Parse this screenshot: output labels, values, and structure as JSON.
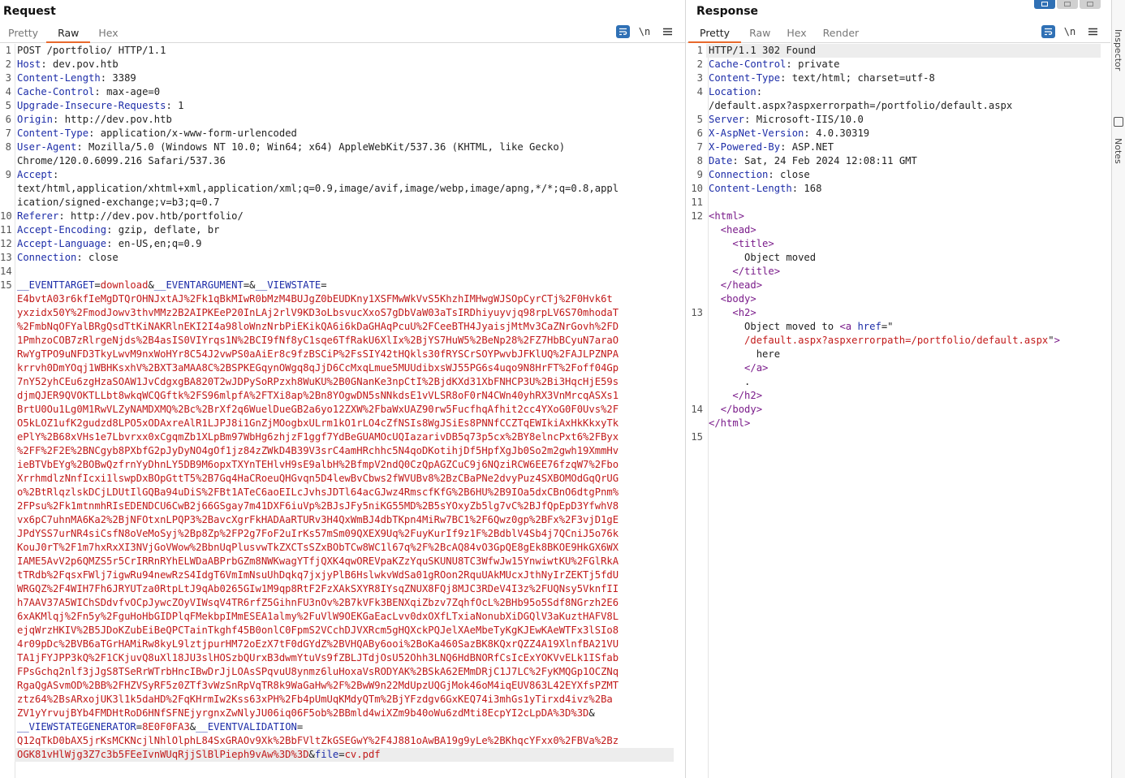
{
  "request": {
    "title": "Request",
    "tabs": [
      "Pretty",
      "Raw",
      "Hex"
    ],
    "active_tab": 1,
    "newline_label": "\\n",
    "headers": [
      {
        "n": "1",
        "plain": "POST /portfolio/ HTTP/1.1"
      },
      {
        "n": "2",
        "key": "Host",
        "value": " dev.pov.htb"
      },
      {
        "n": "3",
        "key": "Content-Length",
        "value": " 3389"
      },
      {
        "n": "4",
        "key": "Cache-Control",
        "value": " max-age=0"
      },
      {
        "n": "5",
        "key": "Upgrade-Insecure-Requests",
        "value": " 1"
      },
      {
        "n": "6",
        "key": "Origin",
        "value": " http://dev.pov.htb"
      },
      {
        "n": "7",
        "key": "Content-Type",
        "value": " application/x-www-form-urlencoded"
      },
      {
        "n": "8",
        "key": "User-Agent",
        "value": " Mozilla/5.0 (Windows NT 10.0; Win64; x64) AppleWebKit/537.36 (KHTML, like Gecko)"
      },
      {
        "n": "",
        "plain": "Chrome/120.0.6099.216 Safari/537.36"
      },
      {
        "n": "9",
        "key": "Accept",
        "value": ""
      },
      {
        "n": "",
        "plain": "text/html,application/xhtml+xml,application/xml;q=0.9,image/avif,image/webp,image/apng,*/*;q=0.8,appl"
      },
      {
        "n": "",
        "plain": "ication/signed-exchange;v=b3;q=0.7"
      },
      {
        "n": "10",
        "key": "Referer",
        "value": " http://dev.pov.htb/portfolio/"
      },
      {
        "n": "11",
        "key": "Accept-Encoding",
        "value": " gzip, deflate, br"
      },
      {
        "n": "12",
        "key": "Accept-Language",
        "value": " en-US,en;q=0.9"
      },
      {
        "n": "13",
        "key": "Connection",
        "value": " close"
      },
      {
        "n": "14",
        "plain": ""
      }
    ],
    "body": {
      "n": "15",
      "p1": "__EVENTTARGET",
      "v1": "download",
      "p2": "__EVENTARGUMENT",
      "p3": "__VIEWSTATE",
      "viewstate_lines": [
        "E4bvtA03r6kfIeMgDTQrOHNJxtAJ%2Fk1qBkMIwR0bMzM4BUJgZ0bEUDKny1XSFMwWkVvS5KhzhIMHwgWJSOpCyrCTj%2F0Hvk6t",
        "yxzidx50Y%2FmodJowv3thvMMz2B2AIPKEeP20InLAj2rlV9KD3oLbsvucXxoS7gDbVaW03aTsIRDhiyuyvjq98rpLV6S70mhodaT",
        "%2FmbNqOFYalBRgQsdTtKiNAKRlnEKI2I4a98loWnzNrbPiEKikQA6i6kDaGHAqPcuU%2FCeeBTH4JyaisjMtMv3CaZNrGovh%2FD",
        "1PmhzoCOB7zRlrgeNjds%2B4asIS0VIYrqs1N%2BCI9fNf8yC1sqe6TfRakU6XlIx%2BjYS7HuW5%2BeNp28%2FZ7HbBCyuN7araO",
        "RwYgTPO9uNFD3TkyLwvM9nxWoHYr8C54J2vwPS0aAiEr8c9fzBSCiP%2FsSIY42tHQkls30fRYSCrSOYPwvbJFKlUQ%2FAJLPZNPA",
        "krrvh0DmYOqj1WBHKsxhV%2BXT3aMAA8C%2BSPKEGqynOWgq8qJjD6CcMxqLmue5MUUdibxsWJ55PG6s4uqo9N8HrFT%2Foff04Gp",
        "7nY52yhCEu6zgHzaSOAW1JvCdgxgBA820T2wJDPySoRPzxh8WuKU%2B0GNanKe3npCtI%2BjdKXd31XbFNHCP3U%2Bi3HqcHjE59s",
        "djmQJER9QVOKTLLbt8wkqWCQGftk%2FS96mlpfA%2FTXi8ap%2Bn8YOgwDN5sNNkdsE1vVLSR8oF0rN4CWn40yhRX3VnMrcqASXs1",
        "BrtU0Ou1Lg0M1RwVLZyNAMDXMQ%2Bc%2BrXf2q6WuelDueGB2a6yo12ZXW%2FbaWxUAZ90rw5FucfhqAfhit2cc4YXoG0F0Uvs%2F",
        "O5kLOZ1ufK2gudzd8LPO5xODAxreAlR1LJPJ8i1GnZjMOogbxULrm1kO1rLO4cZfNSIs8WgJSiEs8PNNfCCZTqEWIkiAxHkKkxyTk",
        "ePlY%2B68xVHs1e7Lbvrxx0xCgqmZb1XLpBm97WbHg6zhjzF1ggf7YdBeGUAMOcUQIazarivDB5q73p5cx%2BY8elncPxt6%2FByx",
        "%2FF%2F2E%2BNCgyb8PXbfG2pJyDyNO4gOf1jz84zZWkD4B39V3srC4amHRchhc5N4qoDKotihjDf5HpfXgJb0So2m2gwh19XmmHv",
        "ieBTVbEYg%2BOBwQzfrnYyDhnLY5DB9M6opxTXYnTEHlvH9sE9albH%2BfmpV2ndQ0CzQpAGZCuC9j6NQziRCW6EE76fzqW7%2Fbo",
        "XrrhmdlzNnfIcxi1lswpDxBOpGttT5%2B7Gq4HaCRoeuQHGvqn5D4lewBvCbws2fWVUBv8%2BzCBaPNe2dvyPuz4SXBOMOdGqQrUG",
        "o%2BtRlqzlskDCjLDUtIlGQBa94uDiS%2FBt1ATeC6aoEILcJvhsJDTl64acGJwz4RmscfKfG%2B6HU%2B9IOa5dxCBnO6dtgPnm%",
        "2FPsu%2Fk1mtnmhRIsEDENDCU6CwB2j66GSgay7m41DXF6iuVp%2BJsJFy5niKG55MD%2B5sYOxyZb5lg7vC%2BJfQpEpD3YfwhV8",
        "vx6pC7uhnMA6Ka2%2BjNFOtxnLPQP3%2BavcXgrFkHADAaRTURv3H4QxWmBJ4dbTKpn4MiRw7BC1%2F6Qwz0gp%2BFx%2F3vjD1gE",
        "JPdYSS7urNR4siCsfN8oVeMoSyj%2Bp8Zp%2FP2g7FoF2uIrKs57mSm09QXEX9Uq%2FuyKurIf9z1F%2BdblV4Sb4j7QCniJ5o76k",
        "KouJ0rT%2F1m7hxRxXI3NVjGoVWow%2BbnUqPlusvwTkZXCTsSZxBObTCw8WC1l67q%2F%2BcAQ84vO3GpQE8gEk8BKOE9HkGX6WX",
        "IAME5AvV2p6QMZS5r5CrIRRnRYhELWDaABPrbGZm8NWKwagYTfjQXK4qwOREVpaKZzYquSKUNU8TC3WfwJw15YnwiwtKU%2FGlRkA",
        "tTRdb%2FqsxFWlj7igwRu94newRzS4IdgT6VmImNsuUhDqkq7jxjyPlB6HslwkvWdSa01gROon2RquUAkMUcxJthNyIrZEKTj5fdU",
        "WRGQZ%2F4WIH7Fh6JRYUTza0RtpLtJ9qAb0265GIw1M9qp8RtF2FzXAkSXYR8IYsqZNUX8FQj8MJC3RDeV4I3z%2FUQNsy5VknfII",
        "h7AAV37A5WIChSDdvfvOCpJywcZOyVIWsqV4TR6rfZ5GihnFU3nOv%2B7kVFk3BENXqiZbzv7ZqhfOcL%2BHb95o5Sdf8NGrzh2E6",
        "6xAKMlqj%2Fn5y%2FguHoHbGIDPlqFMekbpIMmESEA1almy%2FuVlW9OEKGaEacLvv0dxOXfLTxiaNonubXiDGQlV3aKuztHAFV8L",
        "ejqWrzHKIV%2B5JDoKZubEiBeQPCTainTkghf45B0onlC0FpmS2VCchDJVXRcm5gHQXckPQJelXAeMbeTyKgKJEwKAeWTFx3lSIo8",
        "4r09pDc%2BVB6aTGrHAMiRw8kyL9lztjpurHM72oEzX7tF0dGYdZ%2BVHQABy6ooi%2BoKa460SazBK8KQxrQZZ4A19XlnfBA21VU",
        "TA1jFYJPP3kQ%2F1CKjuvQ8uXl18JU3slHOSzbQUrxB3dwmYtuVs9fZBLJTdjOsU52Ohh3LNQ6HdBNORfCsIcExYOKVvELk1ISfab",
        "FPsGchq2nlf3jJgS8TSeRrWTrbHncIBwDrJjLOAsSPqvuU8ynmz6luHoxaVsRODYAK%2BSkA62EMmDRjC1J7LC%2FyKMQGp1OCZNq",
        "RgaQgASvmOD%2BB%2FHZVSyRF5z0ZTf3vWzSnRpVqTR8k9WaGaHw%2F%2BwW9n22MdUpzUQGjMok46oM4iqEUV863L42EYXfsPZMT",
        "ztz64%2BsARxojUK3l1k5daHD%2FqKHrmIw2Kss63xPH%2Fb4pUmUqKMdyQTm%2BjYFzdgv6GxKEQ74i3mhGs1yTirxd4ivz%2Ba",
        "ZV1yYrvujBYb4FMDHtRoD6HNfSFNEjyrgnxZwNlyJU06iq06F5ob%2BBmld4wiXZm9b40oWu6zdMti8EcpYI2cLpDA%3D%3D"
      ],
      "p4": "__VIEWSTATEGENERATOR",
      "v4": "8E0F0FA3",
      "p5": "__EVENTVALIDATION",
      "ev_lines": [
        "Q12qTkD0bAX5jrKsMCKNcjlNhlOlphL84SxGRAOv9Xk%2BbFVltZkGSEGwY%2F4J881oAwBA19g9yLe%2BKhqcYFxx0%2FBVa%2Bz",
        "OGK81vHlWjg3Z7c3b5FEeIvnWUqRjjSlBlPieph9vAw%3D%3D"
      ],
      "p6": "file",
      "v6": "cv.pdf"
    }
  },
  "response": {
    "title": "Response",
    "tabs": [
      "Pretty",
      "Raw",
      "Hex",
      "Render"
    ],
    "active_tab": 0,
    "newline_label": "\\n",
    "headers": [
      {
        "n": "1",
        "plain": "HTTP/1.1 302 Found"
      },
      {
        "n": "2",
        "key": "Cache-Control",
        "value": " private"
      },
      {
        "n": "3",
        "key": "Content-Type",
        "value": " text/html; charset=utf-8"
      },
      {
        "n": "4",
        "key": "Location",
        "value": ""
      },
      {
        "n": "",
        "plain": "/default.aspx?aspxerrorpath=/portfolio/default.aspx"
      },
      {
        "n": "5",
        "key": "Server",
        "value": " Microsoft-IIS/10.0"
      },
      {
        "n": "6",
        "key": "X-AspNet-Version",
        "value": " 4.0.30319"
      },
      {
        "n": "7",
        "key": "X-Powered-By",
        "value": " ASP.NET"
      },
      {
        "n": "8",
        "key": "Date",
        "value": " Sat, 24 Feb 2024 12:08:11 GMT"
      },
      {
        "n": "9",
        "key": "Connection",
        "value": " close"
      },
      {
        "n": "10",
        "key": "Content-Length",
        "value": " 168"
      },
      {
        "n": "11",
        "plain": ""
      }
    ],
    "html_body": {
      "n_html": "12",
      "n_h2": "13",
      "n_close_body": "14",
      "n_last": "15",
      "title_text": "Object moved",
      "h2_text": "Object moved to ",
      "href_attr": "href",
      "href_value": "/default.aspx?aspxerrorpath=/portfolio/default.aspx",
      "link_text": "here",
      "period": "."
    }
  },
  "side_rail": {
    "labels": [
      "Inspector",
      "Notes"
    ]
  }
}
